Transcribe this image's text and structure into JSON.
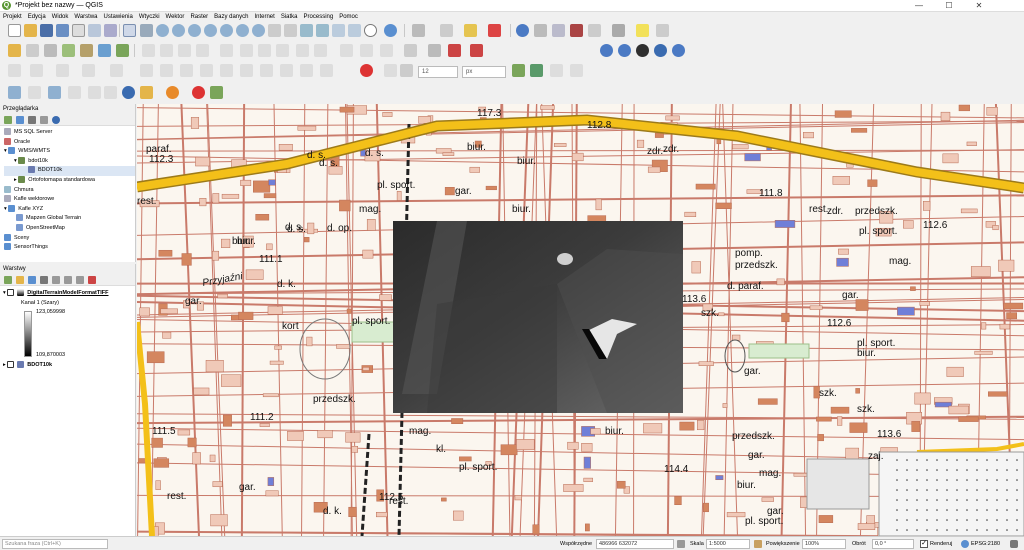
{
  "window": {
    "title": "*Projekt bez nazwy — QGIS",
    "minimize": "—",
    "maximize": "☐",
    "close": "✕"
  },
  "menu": [
    "Projekt",
    "Edycja",
    "Widok",
    "Warstwa",
    "Ustawienia",
    "Wtyczki",
    "Wektor",
    "Raster",
    "Bazy danych",
    "Internet",
    "Siatka",
    "Processing",
    "Pomoc"
  ],
  "toolbar3": {
    "font_size": "12",
    "unit": "px"
  },
  "browser": {
    "title": "Przeglądarka",
    "items": [
      {
        "label": "MS SQL Server",
        "indent": 0
      },
      {
        "label": "Oracle",
        "indent": 0
      },
      {
        "label": "WMS/WMTS",
        "indent": 0
      },
      {
        "label": "bdot10k",
        "indent": 1
      },
      {
        "label": "BDOT10k",
        "indent": 2
      },
      {
        "label": "Ortofotomapa standardowa",
        "indent": 1
      },
      {
        "label": "Chmura",
        "indent": 0
      },
      {
        "label": "Kafle wektorowe",
        "indent": 0
      },
      {
        "label": "Kafle XYZ",
        "indent": 0
      },
      {
        "label": "Mapzen Global Terrain",
        "indent": 1
      },
      {
        "label": "OpenStreetMap",
        "indent": 1
      },
      {
        "label": "Sceny",
        "indent": 0
      },
      {
        "label": "SensorThings",
        "indent": 0
      }
    ]
  },
  "layers": {
    "title": "Warstwy",
    "dtm": {
      "name": "DigitalTerrainModelFormatTIFF",
      "band": "Kanał 1 (Szary)",
      "max": "123,059998",
      "min": "109,870003"
    },
    "bdot": {
      "name": "BDOT10k"
    }
  },
  "status": {
    "search_placeholder": "Szukana fraza (Ctrl+K)",
    "coord_label": "Współrzędne",
    "coord_value": "486966  632072",
    "scale_label": "Skala",
    "scale_value": "1:5000",
    "magnifier_label": "Powiększenie",
    "magnifier_value": "100%",
    "rotation_label": "Obrót",
    "rotation_value": "0,0 °",
    "render_label": "Renderuj",
    "crs": "EPSG:2180"
  },
  "map_labels": [
    "112.3",
    "117.3",
    "112.8",
    "d. s.",
    "d. s.",
    "pl. sport.",
    "rest.",
    "biur.",
    "biur.",
    "biur.",
    "zdr.",
    "gar.",
    "mag.",
    "d. s.",
    "d. s.",
    "d. op.",
    "biur.",
    "111.1",
    "d. k.",
    "Przyjaźni",
    "gar.",
    "pl. sport.",
    "kort",
    "biur.",
    "111.8",
    "zdr.",
    "przedszk.",
    "112.6",
    "pl. sport.",
    "mag.",
    "rest.",
    "pomp.",
    "przedszk.",
    "d. paraf.",
    "113.6",
    "szk.",
    "gar.",
    "112.6",
    "pl. sport.",
    "biur.",
    "szk.",
    "111.5",
    "111.2",
    "przedszk.",
    "mag.",
    "biur.",
    "pl. sport.",
    "112.5",
    "kl.",
    "rest.",
    "gar.",
    "114.4",
    "przedszk.",
    "gar.",
    "113.6",
    "zaj.",
    "mag.",
    "biur.",
    "gar.",
    "pl. sport.",
    "d. k.",
    "rest.",
    "szk.",
    "gar.",
    "paraf.",
    "d. s.",
    "zdr."
  ],
  "colors": {
    "road_yellow": "#f3c019",
    "building": "#e8a88a",
    "accent": "#589632"
  }
}
